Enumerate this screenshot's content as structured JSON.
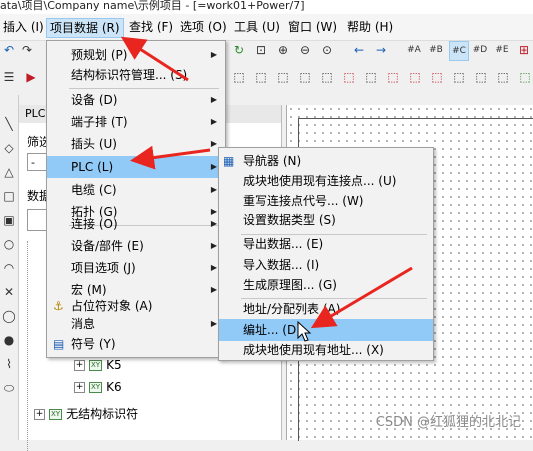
{
  "title_text": "ata\\项目\\Company name\\示例项目 - [=work01+Power/7]",
  "menubar": {
    "items": [
      {
        "label": "插入 (I)"
      },
      {
        "label": "项目数据 (R)"
      },
      {
        "label": "查找 (F)"
      },
      {
        "label": "选项 (O)"
      },
      {
        "label": "工具 (U)"
      },
      {
        "label": "窗口 (W)"
      },
      {
        "label": "帮助 (H)"
      }
    ]
  },
  "left_panel": {
    "header": "PLC",
    "filter_label": "筛选",
    "data_label": "数据"
  },
  "tree": {
    "k5": "K5",
    "k6": "K6",
    "unstructured": "无结构标识符"
  },
  "project_menu": {
    "items": [
      {
        "label": "预规划 (P)",
        "submenu": true
      },
      {
        "label": "结构标识符管理... (S)",
        "submenu": false
      },
      {
        "label": "设备 (D)",
        "submenu": true
      },
      {
        "label": "端子排 (T)",
        "submenu": true
      },
      {
        "label": "插头 (U)",
        "submenu": true
      },
      {
        "label": "PLC (L)",
        "submenu": true,
        "highlighted": true
      },
      {
        "label": "电缆 (C)",
        "submenu": true
      },
      {
        "label": "拓扑 (G)",
        "submenu": true
      },
      {
        "label": "连接 (O)",
        "submenu": true
      },
      {
        "label": "设备/部件 (E)",
        "submenu": true
      },
      {
        "label": "项目选项 (J)",
        "submenu": true
      },
      {
        "label": "宏 (M)",
        "submenu": true
      },
      {
        "label": "占位符对象 (A)",
        "submenu": false
      },
      {
        "label": "消息",
        "submenu": true
      },
      {
        "label": "符号 (Y)",
        "submenu": false
      }
    ]
  },
  "plc_menu": {
    "items": [
      {
        "label": "导航器 (N)"
      },
      {
        "label": "成块地使用现有连接点... (U)"
      },
      {
        "label": "重写连接点代号... (W)"
      },
      {
        "label": "设置数据类型 (S)"
      },
      {
        "label": "导出数据... (E)"
      },
      {
        "label": "导入数据... (I)"
      },
      {
        "label": "生成原理图... (G)"
      },
      {
        "label": "地址/分配列表 (A)"
      },
      {
        "label": "编址... (D)",
        "highlighted": true
      },
      {
        "label": "成块地使用现有地址... (X)"
      }
    ]
  },
  "watermark": "CSDN @红狐狸的北北记",
  "colors": {
    "menu_highlight": "#91c9f7",
    "annotation_arrow": "#e8251f",
    "menu_bg": "#f2f2f2"
  }
}
